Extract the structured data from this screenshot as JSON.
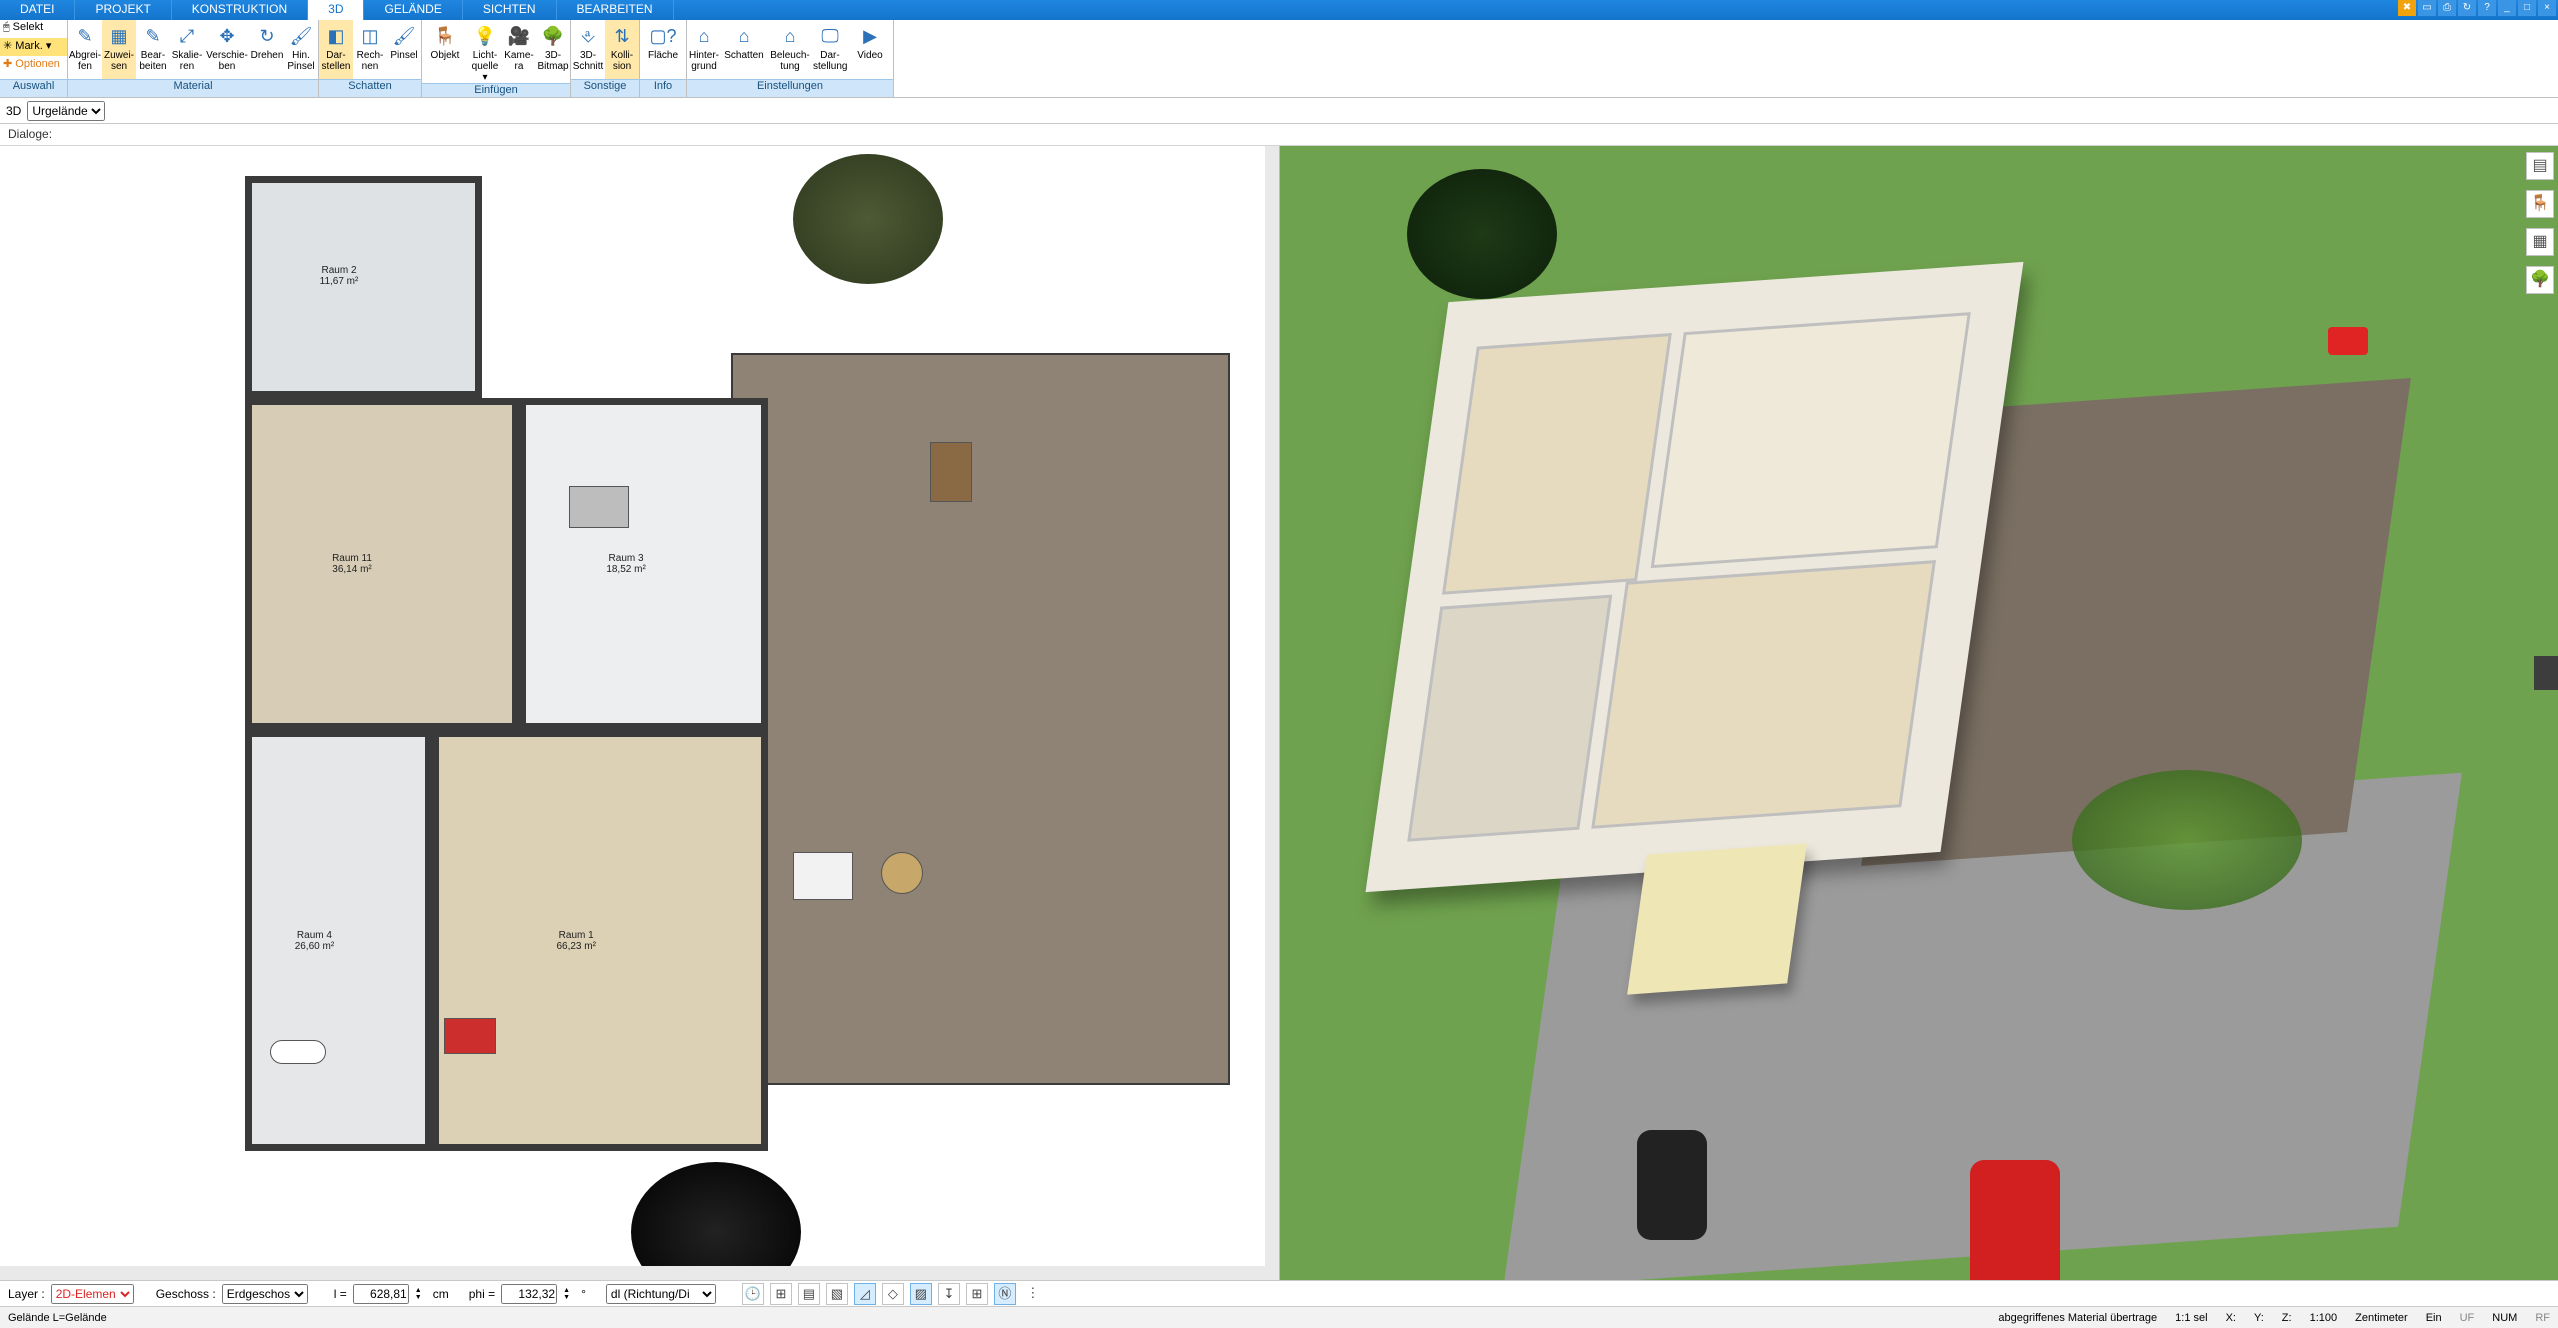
{
  "menus": {
    "datei": "DATEI",
    "projekt": "PROJEKT",
    "konstruktion": "KONSTRUKTION",
    "d3": "3D",
    "gelaende": "GELÄNDE",
    "sichten": "SICHTEN",
    "bearbeiten": "BEARBEITEN"
  },
  "ribbon_left": {
    "selekt": "Selekt",
    "mark": "Mark.",
    "optionen": "Optionen",
    "caption": "Auswahl"
  },
  "groups": {
    "material": {
      "caption": "Material",
      "btns": {
        "abgreifen": "Abgrei-\nfen",
        "zuweisen": "Zuwei-\nsen",
        "bearbeiten": "Bear-\nbeiten",
        "skalieren": "Skalie-\nren",
        "verschieben": "Verschie-\nben",
        "drehen": "Drehen",
        "hinpinsel": "Hin.\nPinsel"
      }
    },
    "schatten": {
      "caption": "Schatten",
      "btns": {
        "darstellen": "Dar-\nstellen",
        "rechnen": "Rech-\nnen",
        "pinsel": "Pinsel"
      }
    },
    "einfuegen": {
      "caption": "Einfügen",
      "btns": {
        "objekt": "Objekt",
        "licht": "Licht-\nquelle",
        "kamera": "Kame-\nra",
        "bitmap": "3D-\nBitmap"
      }
    },
    "sonstige": {
      "caption": "Sonstige",
      "btns": {
        "schnitt": "3D-\nSchnitt",
        "kollision": "Kolli-\nsion"
      }
    },
    "info": {
      "caption": "Info",
      "btns": {
        "flaeche": "Fläche"
      }
    },
    "einstellungen": {
      "caption": "Einstellungen",
      "btns": {
        "hintergrund": "Hinter-\ngrund",
        "schatten": "Schatten",
        "beleuchtung": "Beleuch-\ntung",
        "darstellung": "Dar-\nstellung",
        "video": "Video"
      }
    }
  },
  "subbar": {
    "mode": "3D",
    "layer": "Urgelände"
  },
  "dialogs_label": "Dialoge:",
  "rooms": {
    "r1": {
      "name": "Raum 1",
      "area": "66,23 m²"
    },
    "r2": {
      "name": "Raum 2",
      "area": "11,67 m²"
    },
    "r3": {
      "name": "Raum 3",
      "area": "18,52 m²"
    },
    "r4": {
      "name": "Raum 4",
      "area": "26,60 m²"
    },
    "r11": {
      "name": "Raum 11",
      "area": "36,14 m²"
    }
  },
  "bottom": {
    "layer_label": "Layer :",
    "layer_value": "2D-Elemen",
    "geschoss_label": "Geschoss :",
    "geschoss_value": "Erdgeschos",
    "l_label": "l =",
    "l_value": "628,81",
    "l_unit": "cm",
    "phi_label": "phi =",
    "phi_value": "132,32",
    "phi_unit": "°",
    "dl_label": "dl (Richtung/Di"
  },
  "status": {
    "left": "Gelände L=Gelände",
    "material": "abgegriffenes Material übertrage",
    "sel": "1:1 sel",
    "x": "X:",
    "y": "Y:",
    "z": "Z:",
    "scale": "1:100",
    "unit": "Zentimeter",
    "ein": "Ein",
    "uf": "UF",
    "num": "NUM",
    "rf": "RF"
  }
}
